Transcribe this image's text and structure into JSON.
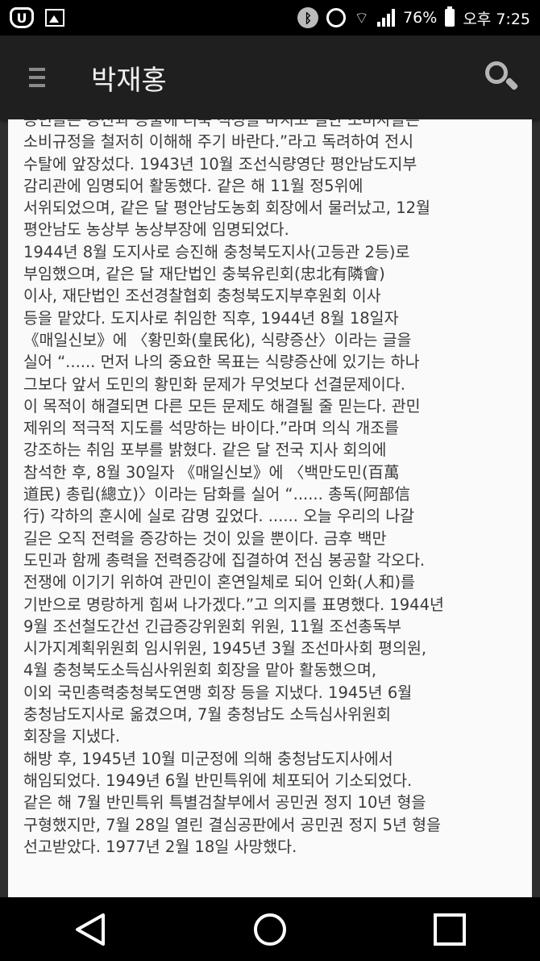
{
  "status_bar": {
    "u_icon_label": "U",
    "bluetooth_symbol": "ᛒ",
    "wifi_symbol": "⌔",
    "battery_percent": "76%",
    "time": "오후 7:25"
  },
  "app_bar": {
    "title": "박재홍"
  },
  "article": {
    "text": "농민들은 증산과 공출에 더욱 적성을 바치고 일반 소비자들은\n소비규정을 철저히 이해해 주기 바란다.”라고 독려하여 전시\n수탈에 앞장섰다. 1943년 10월 조선식량영단 평안남도지부\n감리관에 임명되어 활동했다. 같은 해 11월 정5위에\n서위되었으며, 같은 달 평안남도농회 회장에서 물러났고, 12월\n평안남도 농상부 농상부장에 임명되었다.\n1944년 8월 도지사로 승진해 충청북도지사(고등관 2등)로\n부임했으며, 같은 달 재단법인 충북유린회(忠北有隣會)\n이사, 재단법인 조선경찰협회 충청북도지부후원회 이사\n등을 맡았다. 도지사로 취임한 직후, 1944년 8월 18일자\n《매일신보》에 〈황민화(皇民化), 식량증산〉이라는 글을\n실어 “...... 먼저 나의 중요한 목표는 식량증산에 있기는 하나\n그보다 앞서 도민의 황민화 문제가 무엇보다 선결문제이다.\n이 목적이 해결되면 다른 모든 문제도 해결될 줄 믿는다. 관민\n제위의 적극적 지도를 석망하는 바이다.”라며 의식 개조를\n강조하는 취임 포부를 밝혔다. 같은 달 전국 지사 회의에\n참석한 후, 8월 30일자 《매일신보》에 〈백만도민(百萬\n道民) 총립(總立)〉이라는 담화를 실어 “...... 총독(阿部信\n行) 각하의 훈시에 실로 감명 깊었다. ...... 오늘 우리의 나갈\n길은 오직 전력을 증강하는 것이 있을 뿐이다. 금후 백만\n도민과 함께 총력을 전력증강에 집결하여 전심 봉공할 각오다.\n전쟁에 이기기 위하여 관민이 혼연일체로 되어 인화(人和)를\n기반으로 명랑하게 힘써 나가겠다.”고 의지를 표명했다. 1944년\n9월 조선철도간선 긴급증강위원회 위원, 11월 조선총독부\n시가지계획위원회 임시위원, 1945년 3월 조선마사회 평의원,\n4월 충청북도소득심사위원회 회장을 맡아 활동했으며,\n이외 국민총력충청북도연맹 회장 등을 지냈다. 1945년 6월\n충청남도지사로 옮겼으며, 7월 충청남도 소득심사위원회\n회장을 지냈다.\n해방 후, 1945년 10월 미군정에 의해 충청남도지사에서\n해임되었다. 1949년 6월 반민특위에 체포되어 기소되었다.\n같은 해 7월 반민특위 특별검찰부에서 공민권 정지 10년 형을\n구형했지만, 7월 28일 열린 결심공판에서 공민권 정지 5년 형을\n선고받았다. 1977년 2월 18일 사망했다."
  },
  "nav_bar": {
    "icons": [
      "back-icon",
      "home-icon",
      "recents-icon"
    ]
  }
}
